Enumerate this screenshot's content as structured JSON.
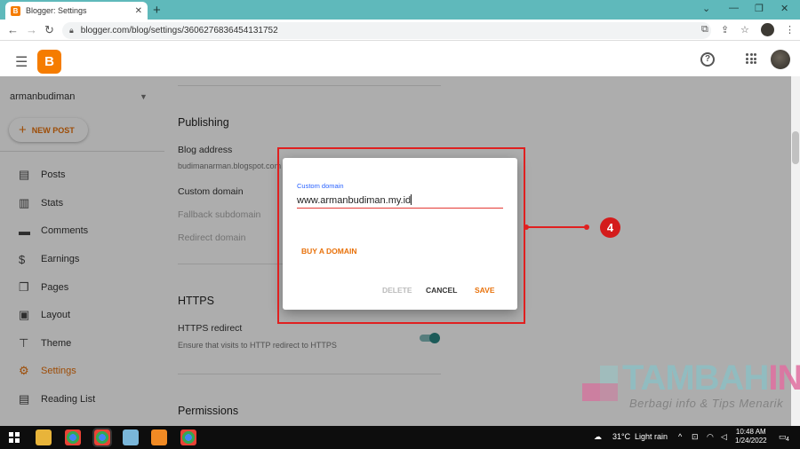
{
  "browser": {
    "tab_title": "Blogger: Settings",
    "tab_close": "✕",
    "new_tab": "+",
    "url": "blogger.com/blog/settings/3606276836454131752",
    "window_controls": [
      "⌄",
      "—",
      "❐",
      "✕"
    ]
  },
  "header": {
    "logo_letter": "B",
    "help": "?"
  },
  "sidebar": {
    "blog_name": "armanbudiman",
    "new_post_label": "NEW POST",
    "items": [
      {
        "label": "Posts",
        "icon": "▤"
      },
      {
        "label": "Stats",
        "icon": "▥"
      },
      {
        "label": "Comments",
        "icon": "▬"
      },
      {
        "label": "Earnings",
        "icon": "$"
      },
      {
        "label": "Pages",
        "icon": "❐"
      },
      {
        "label": "Layout",
        "icon": "▣"
      },
      {
        "label": "Theme",
        "icon": "⊤"
      },
      {
        "label": "Settings",
        "icon": "⚙"
      },
      {
        "label": "Reading List",
        "icon": "▤"
      }
    ],
    "active_item": "Settings"
  },
  "settings": {
    "publishing_heading": "Publishing",
    "blog_address_label": "Blog address",
    "blog_address_value": "budimanarman.blogspot.com",
    "custom_domain_label": "Custom domain",
    "fallback_subdomain_label": "Fallback subdomain",
    "redirect_domain_label": "Redirect domain",
    "https_heading": "HTTPS",
    "https_redirect_label": "HTTPS redirect",
    "https_redirect_desc": "Ensure that visits to HTTP redirect to HTTPS",
    "https_redirect_on": true,
    "permissions_heading": "Permissions"
  },
  "dialog": {
    "field_label": "Custom domain",
    "field_value": "www.armanbudiman.my.id",
    "buy_domain": "BUY A DOMAIN",
    "delete": "DELETE",
    "cancel": "CANCEL",
    "save": "SAVE"
  },
  "annotation": {
    "step_number": "4"
  },
  "watermark": {
    "brand_part1": "TAMBAH",
    "brand_part2": "INFO",
    "tagline": "Berbagi info & Tips Menarik"
  },
  "taskbar": {
    "weather_temp": "31°C",
    "weather_desc": "Light rain",
    "time": "10:48 AM",
    "date": "1/24/2022",
    "notification_count": "4"
  },
  "colors": {
    "accent_orange": "#e8710a",
    "annotation_red": "#e02020",
    "chrome_frame": "#5fb9bb"
  }
}
